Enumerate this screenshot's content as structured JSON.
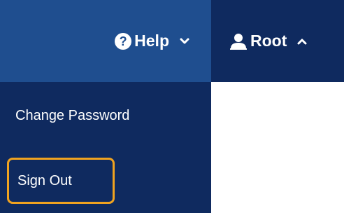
{
  "header": {
    "help": {
      "label": "Help",
      "icon": "help-circle-icon",
      "chevron": "chevron-down-icon"
    },
    "user": {
      "label": "Root",
      "icon": "user-icon",
      "chevron": "chevron-up-icon"
    }
  },
  "user_menu": {
    "items": [
      {
        "label": "Change Password"
      },
      {
        "label": "Sign Out",
        "highlighted": true
      }
    ]
  },
  "colors": {
    "header_bg": "#1f4e8f",
    "active_bg": "#0f2a5f",
    "highlight_border": "#f0a320",
    "text": "#ffffff"
  }
}
